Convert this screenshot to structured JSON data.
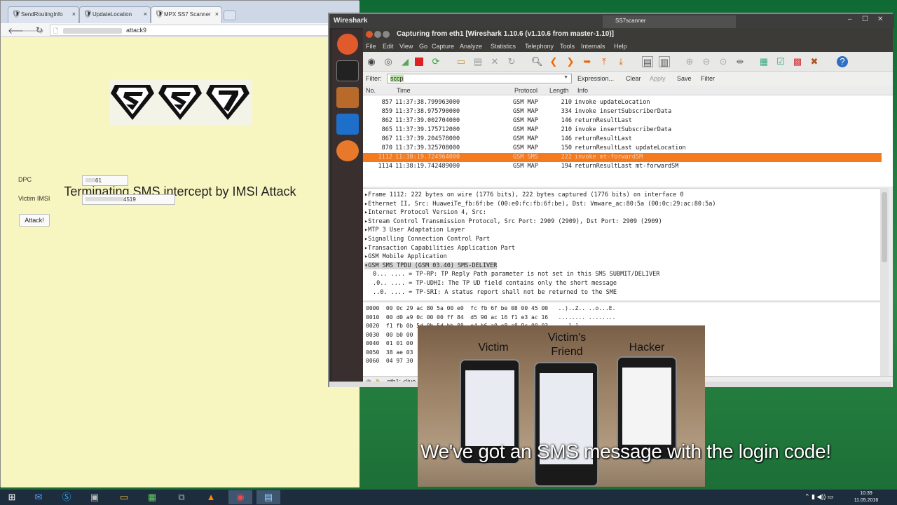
{
  "browser": {
    "tabs": [
      {
        "label": "SendRoutingInfo",
        "close": "×"
      },
      {
        "label": "UpdateLocation",
        "close": "×"
      },
      {
        "label": "MPX SS7 Scanner",
        "close": "×"
      }
    ],
    "url": "attack9",
    "title": "Terminating SMS intercept by IMSI Attack",
    "dpc_label": "DPC",
    "dpc_value": "61",
    "imsi_label": "Victim IMSI",
    "imsi_value": "4519",
    "attack_button": "Attack!"
  },
  "wireshark": {
    "outer_title": "Wireshark",
    "ss7_tab": "SS7scanner",
    "window_title": "Capturing from eth1   [Wireshark 1.10.6  (v1.10.6 from master-1.10)]",
    "menu": [
      "File",
      "Edit",
      "View",
      "Go",
      "Capture",
      "Analyze",
      "Statistics",
      "Telephony",
      "Tools",
      "Internals",
      "Help"
    ],
    "filter_label": "Filter:",
    "filter_value": "sccp",
    "filter_buttons": [
      "Expression...",
      "Clear",
      "Apply",
      "Save",
      "Filter"
    ],
    "columns": [
      "No.",
      "Time",
      "Protocol",
      "Length",
      "Info"
    ],
    "packets": [
      {
        "no": "857",
        "time": "11:37:38.799963000",
        "proto": "GSM MAP",
        "len": "210",
        "info": "invoke updateLocation"
      },
      {
        "no": "859",
        "time": "11:37:38.975790000",
        "proto": "GSM MAP",
        "len": "334",
        "info": "invoke insertSubscriberData"
      },
      {
        "no": "862",
        "time": "11:37:39.002704000",
        "proto": "GSM MAP",
        "len": "146",
        "info": "returnResultLast"
      },
      {
        "no": "865",
        "time": "11:37:39.175712000",
        "proto": "GSM MAP",
        "len": "210",
        "info": "invoke insertSubscriberData"
      },
      {
        "no": "867",
        "time": "11:37:39.204578000",
        "proto": "GSM MAP",
        "len": "146",
        "info": "returnResultLast"
      },
      {
        "no": "870",
        "time": "11:37:39.325708000",
        "proto": "GSM MAP",
        "len": "150",
        "info": "returnResultLast updateLocation"
      },
      {
        "no": "1112",
        "time": "11:38:19.724964000",
        "proto": "GSM SMS",
        "len": "222",
        "info": "invoke mt-forwardSM"
      },
      {
        "no": "1114",
        "time": "11:38:19.742489000",
        "proto": "GSM MAP",
        "len": "194",
        "info": "returnResultLast mt-forwardSM"
      }
    ],
    "details": [
      "Frame 1112: 222 bytes on wire (1776 bits), 222 bytes captured (1776 bits) on interface 0",
      "Ethernet II, Src: HuaweiTe_fb:6f:be (00:e0:fc:fb:6f:be), Dst: Vmware_ac:80:5a (00:0c:29:ac:80:5a)",
      "Internet Protocol Version 4, Src:",
      "Stream Control Transmission Protocol, Src Port: 2909 (2909), Dst Port: 2909 (2909)",
      "MTP 3 User Adaptation Layer",
      "Signalling Connection Control Part",
      "Transaction Capabilities Application Part",
      "GSM Mobile Application",
      "GSM SMS TPDU (GSM 03.40) SMS-DELIVER"
    ],
    "sub_details": [
      "0... .... = TP-RP: TP Reply Path parameter is not set in this SMS SUBMIT/DELIVER",
      ".0.. .... = TP-UDHI: The TP UD field contains only the short message",
      "..0. .... = TP-SRI: A status report shall not be returned to the SME"
    ],
    "hex": [
      "0000  00 0c 29 ac 80 5a 00 e0  fc fb 6f be 08 00 45 00   ..)..Z.. ..o...E.",
      "0010  00 d0 a9 0c 00 00 ff 84  d5 90 ac 16 f1 e3 ac 16   ........ ........",
      "0020  f1 fb 0b 5d 0b 5d bb 88  e4 b6 a0 e8 a8 9c 00 03   ...].]... ........",
      "0030  00 b0 00",
      "0040  01 01 00",
      "0050  38 ae 03",
      "0060  04 97 30"
    ],
    "status": "eth1: <live"
  },
  "video": {
    "labels": [
      "Victim",
      "Victim's Friend",
      "Hacker"
    ],
    "caption": "We've got an SMS message with the login code!"
  },
  "taskbar": {
    "time": "10:39",
    "date": "11.05.2016"
  }
}
